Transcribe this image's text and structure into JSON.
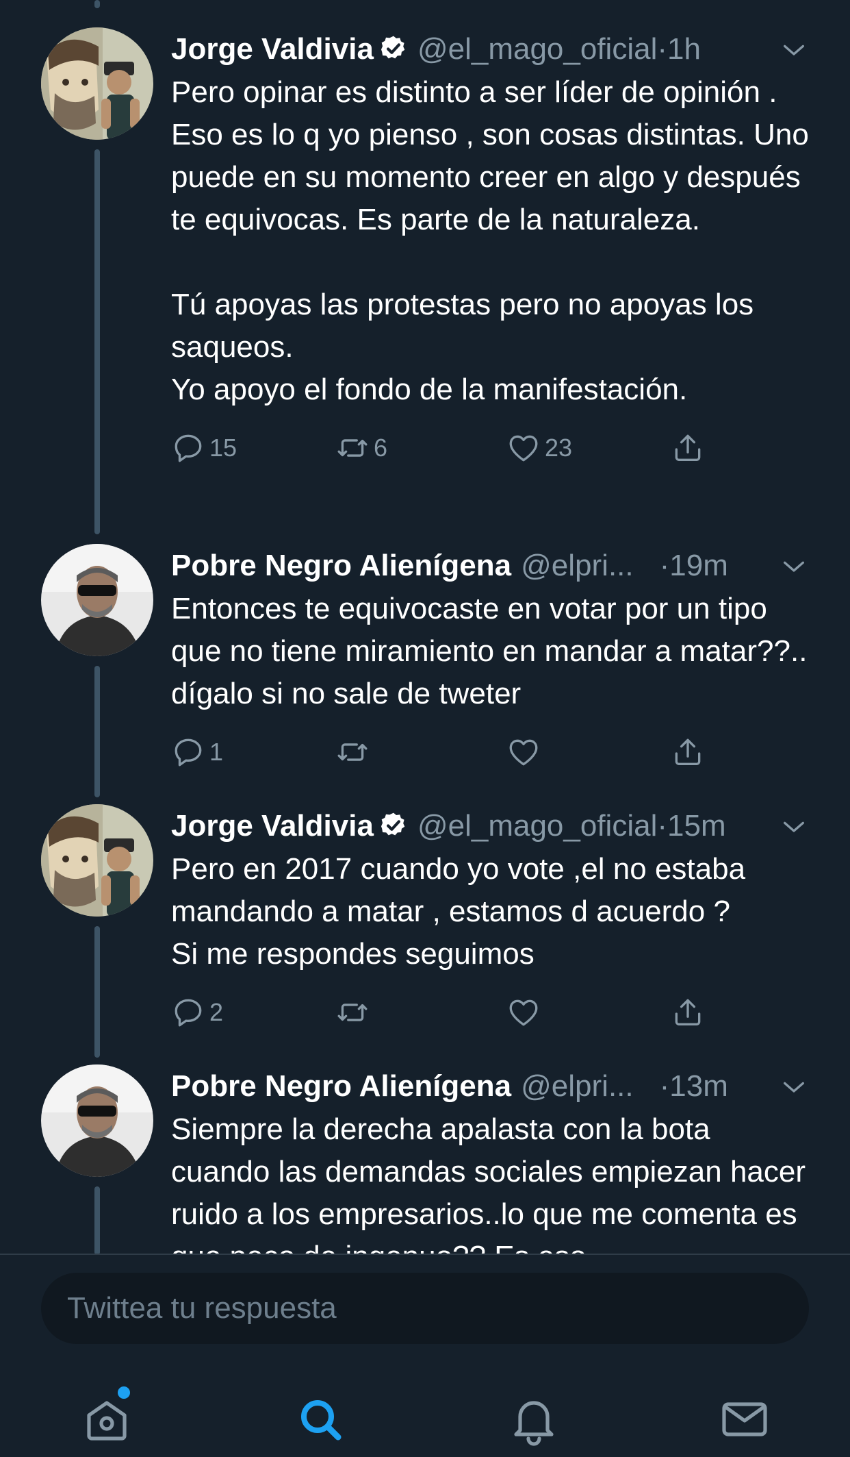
{
  "tweets": [
    {
      "name": "Jorge Valdivia",
      "verified": true,
      "handle": "@el_mago_oficial",
      "separator": "·",
      "time": "1h",
      "paragraphs": [
        "Pero opinar es distinto a ser líder de opinión .  Eso es lo q yo pienso , son cosas distintas. Uno puede en su momento creer en algo y después te equivocas. Es parte de la naturaleza.",
        "Tú apoyas las protestas pero no apoyas los saqueos.",
        "Yo apoyo el fondo de la manifestación."
      ],
      "replies": "15",
      "retweets": "6",
      "likes": "23"
    },
    {
      "name": "Pobre Negro Alienígena",
      "verified": false,
      "handle": "@elpri...",
      "separator": "·",
      "time": "19m",
      "paragraphs": [
        "Entonces te equivocaste en votar por un tipo que no tiene miramiento en mandar a matar??.. dígalo si no sale de tweter"
      ],
      "replies": "1",
      "retweets": "",
      "likes": ""
    },
    {
      "name": "Jorge Valdivia",
      "verified": true,
      "handle": "@el_mago_oficial",
      "separator": "·",
      "time": "15m",
      "paragraphs": [
        "Pero en 2017 cuando yo vote ,el no estaba mandando a matar , estamos d acuerdo ?",
        "Si me respondes seguimos"
      ],
      "replies": "2",
      "retweets": "",
      "likes": ""
    },
    {
      "name": "Pobre Negro Alienígena",
      "verified": false,
      "handle": "@elpri...",
      "separator": "·",
      "time": "13m",
      "paragraphs": [
        "Siempre la derecha apalasta con la bota cuando las demandas sociales empiezan hacer ruido a los empresarios..lo que me comenta es que peco de ingenuo?? Es eso"
      ],
      "replies": "",
      "retweets": "",
      "likes": ""
    }
  ],
  "reply_box": {
    "placeholder": "Twittea tu respuesta"
  },
  "tabbar": {
    "items": [
      "home-icon",
      "search-icon",
      "notifications-icon",
      "messages-icon"
    ],
    "active": "search-icon",
    "accent": "#1da1f2"
  },
  "colors": {
    "background": "#15202b",
    "text": "#ffffff",
    "secondary": "#8899a6",
    "thread_line": "#3d5466"
  }
}
